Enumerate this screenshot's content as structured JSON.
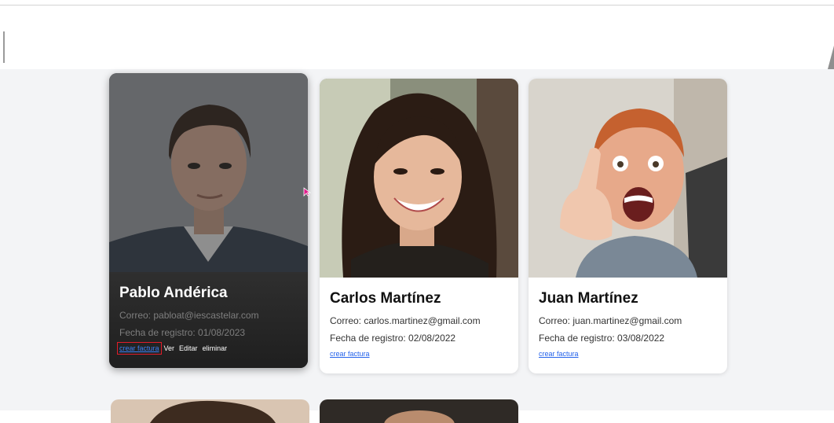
{
  "cards": [
    {
      "name": "Pablo Andérica",
      "email": "Correo: pabloat@iescastelar.com",
      "date": "Fecha de registro: 01/08/2023",
      "link": "crear factura",
      "actions": [
        "Ver",
        "Editar",
        "eliminar"
      ]
    },
    {
      "name": "Carlos Martínez",
      "email": "Correo: carlos.martinez@gmail.com",
      "date": "Fecha de registro: 02/08/2022",
      "link": "crear factura"
    },
    {
      "name": "Juan Martínez",
      "email": "Correo: juan.martinez@gmail.com",
      "date": "Fecha de registro: 03/08/2022",
      "link": "crear factura"
    }
  ],
  "colors": {
    "page_bg": "#f3f4f6",
    "link": "#2563eb",
    "highlight_border": "#e11d2a"
  },
  "icons": [
    "cursor-arrow-icon"
  ]
}
